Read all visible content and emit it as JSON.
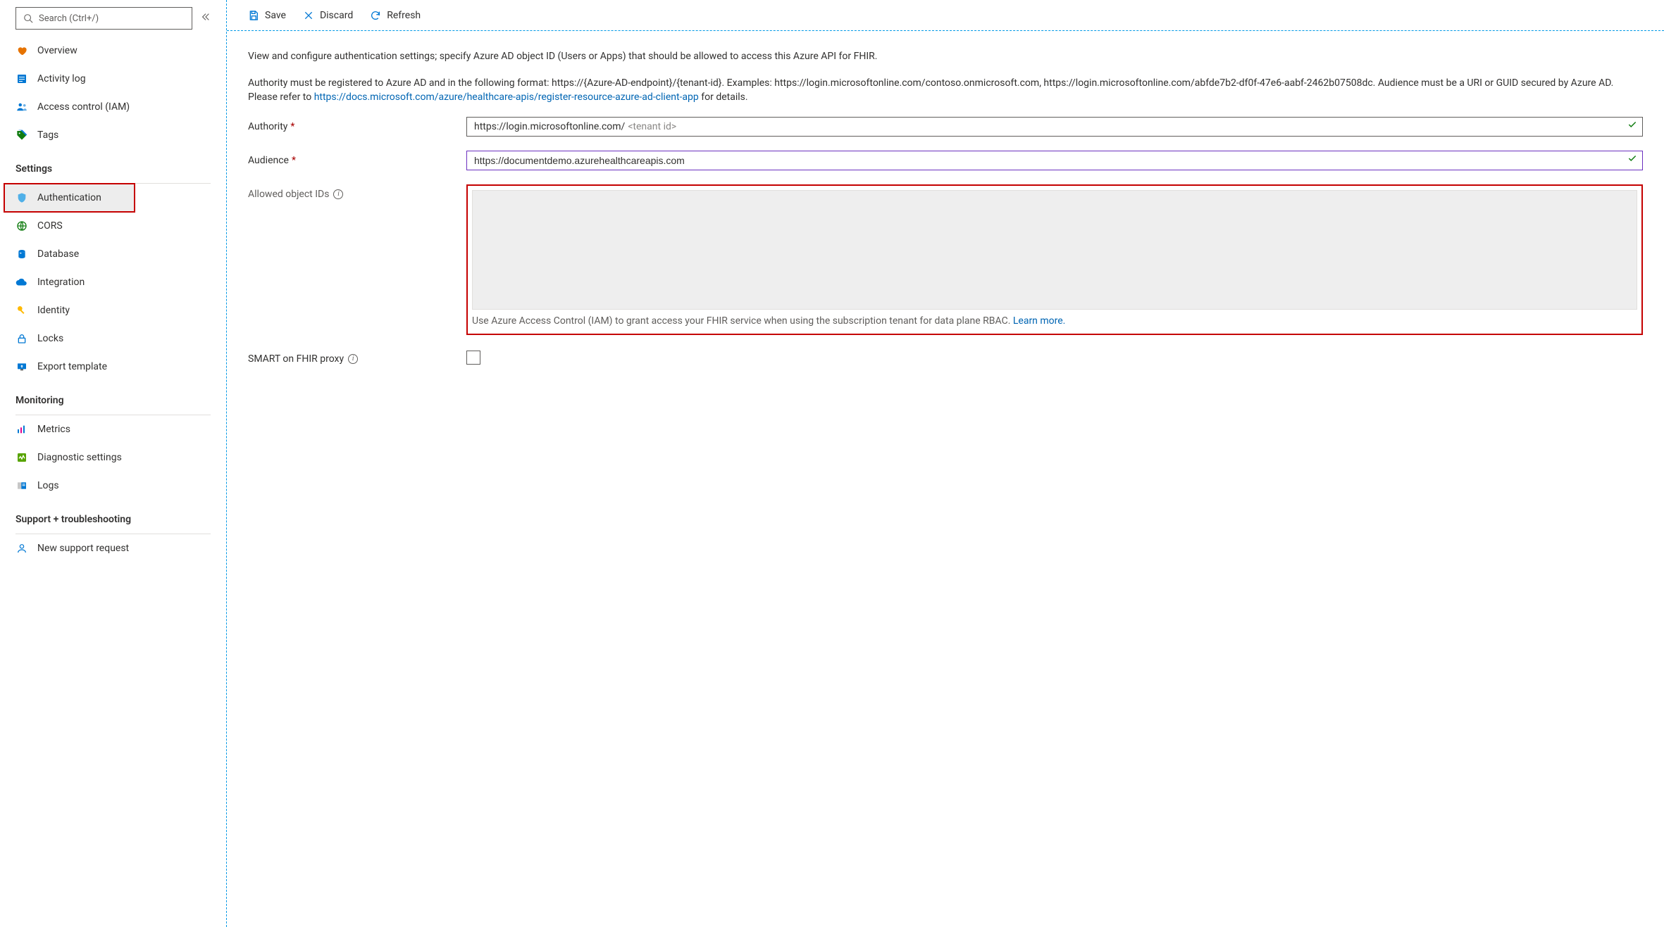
{
  "search": {
    "placeholder": "Search (Ctrl+/)"
  },
  "sidebar": {
    "top": [
      {
        "label": "Overview"
      },
      {
        "label": "Activity log"
      },
      {
        "label": "Access control (IAM)"
      },
      {
        "label": "Tags"
      }
    ],
    "groups": {
      "settings": "Settings",
      "monitoring": "Monitoring",
      "support": "Support + troubleshooting"
    },
    "settings": [
      {
        "label": "Authentication"
      },
      {
        "label": "CORS"
      },
      {
        "label": "Database"
      },
      {
        "label": "Integration"
      },
      {
        "label": "Identity"
      },
      {
        "label": "Locks"
      },
      {
        "label": "Export template"
      }
    ],
    "monitoring": [
      {
        "label": "Metrics"
      },
      {
        "label": "Diagnostic settings"
      },
      {
        "label": "Logs"
      }
    ],
    "support": [
      {
        "label": "New support request"
      }
    ]
  },
  "toolbar": {
    "save": "Save",
    "discard": "Discard",
    "refresh": "Refresh"
  },
  "content": {
    "intro1": "View and configure authentication settings; specify Azure AD object ID (Users or Apps) that should be allowed to access this Azure API for FHIR.",
    "intro2a": "Authority must be registered to Azure AD and in the following format: https://{Azure-AD-endpoint}/{tenant-id}. Examples: https://login.microsoftonline.com/contoso.onmicrosoft.com, https://login.microsoftonline.com/abfde7b2-df0f-47e6-aabf-2462b07508dc. Audience must be a URI or GUID secured by Azure AD. Please refer to ",
    "intro2_link_text": "https://docs.microsoft.com/azure/healthcare-apis/register-resource-azure-ad-client-app",
    "intro2b": " for details.",
    "authority_label": "Authority",
    "authority_value": "https://login.microsoftonline.com/",
    "authority_placeholder_suffix": "<tenant id>",
    "audience_label": "Audience",
    "audience_value": "https://documentdemo.azurehealthcareapis.com",
    "allowed_label": "Allowed object IDs",
    "allowed_hint_a": "Use Azure Access Control (IAM) to grant access your FHIR service when using the subscription tenant for data plane RBAC. ",
    "allowed_hint_link": "Learn more.",
    "smart_label": "SMART on FHIR proxy"
  }
}
